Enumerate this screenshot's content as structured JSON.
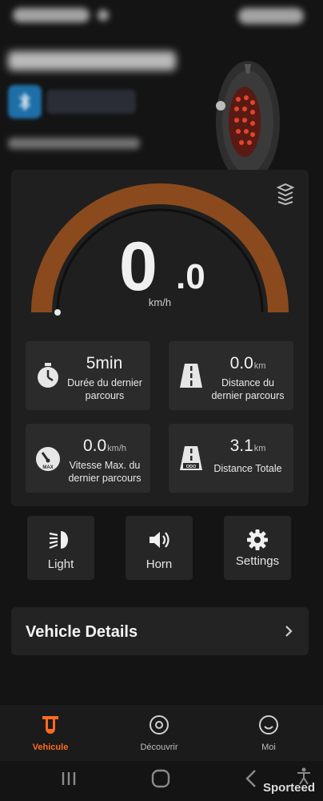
{
  "colors": {
    "accent": "#ff6a1f",
    "gauge_arc": "#8a4a1e",
    "background": "#141414",
    "card": "#2b2b2b"
  },
  "speed": {
    "integer": "0",
    "decimal": ".0",
    "unit": "km/h"
  },
  "stats": [
    {
      "value": "5min",
      "unit": "",
      "label": "Durée du dernier parcours",
      "icon": "stopwatch-icon"
    },
    {
      "value": "0.0",
      "unit": "km",
      "label": "Distance du dernier parcours",
      "icon": "road-icon"
    },
    {
      "value": "0.0",
      "unit": "km/h",
      "label": "Vitesse Max. du dernier parcours",
      "icon": "max-speed-gauge-icon",
      "icon_text": "MAX"
    },
    {
      "value": "3.1",
      "unit": "km",
      "label": "Distance Totale",
      "icon": "odometer-road-icon",
      "icon_text": "ODO"
    }
  ],
  "controls": [
    {
      "label": "Light",
      "icon": "headlight-icon"
    },
    {
      "label": "Horn",
      "icon": "speaker-icon"
    },
    {
      "label": "Settings",
      "icon": "gear-icon"
    }
  ],
  "details": {
    "label": "Vehicle Details"
  },
  "tabs": [
    {
      "label": "Vehicule",
      "icon": "scooter-icon",
      "active": true
    },
    {
      "label": "Découvrir",
      "icon": "discover-icon",
      "active": false
    },
    {
      "label": "Moi",
      "icon": "smile-icon",
      "active": false
    }
  ],
  "watermark": "Sporteed"
}
